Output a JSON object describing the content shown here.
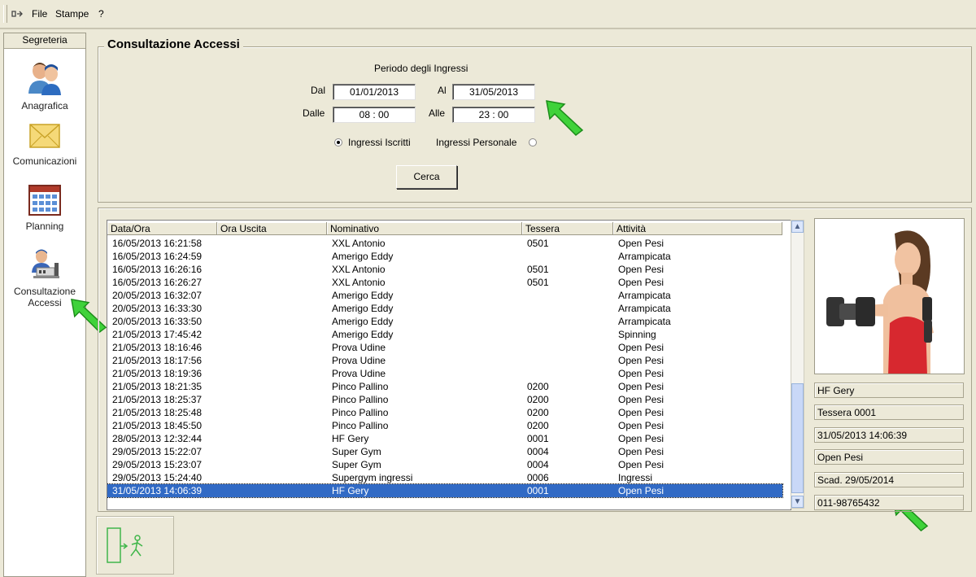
{
  "menu": {
    "items": [
      "File",
      "Stampe",
      "?"
    ]
  },
  "sidebar": {
    "title": "Segreteria",
    "items": [
      {
        "label": "Anagrafica",
        "icon": "people-icon"
      },
      {
        "label": "Comunicazioni",
        "icon": "envelope-icon"
      },
      {
        "label": "Planning",
        "icon": "calendar-grid-icon"
      },
      {
        "label1": "Consultazione",
        "label2": "Accessi",
        "icon": "access-control-icon"
      }
    ]
  },
  "filter": {
    "title": "Consultazione Accessi",
    "period_label": "Periodo degli Ingressi",
    "dal_label": "Dal",
    "dal_value": "01/01/2013",
    "al_label": "Al",
    "al_value": "31/05/2013",
    "dalle_label": "Dalle",
    "dalle_value": "08 : 00",
    "alle_label": "Alle",
    "alle_value": "23 : 00",
    "radio_iscritti": "Ingressi Iscritti",
    "radio_personale": "Ingressi Personale",
    "selected_radio": "Ingressi Iscritti",
    "search_label": "Cerca"
  },
  "table": {
    "columns": [
      "Data/Ora",
      "Ora Uscita",
      "Nominativo",
      "Tessera",
      "Attività"
    ],
    "rows": [
      [
        "16/05/2013 16:21:58",
        "",
        "XXL Antonio",
        "0501",
        "Open Pesi"
      ],
      [
        "16/05/2013 16:24:59",
        "",
        "Amerigo Eddy",
        "",
        "Arrampicata"
      ],
      [
        "16/05/2013 16:26:16",
        "",
        "XXL Antonio",
        "0501",
        "Open Pesi"
      ],
      [
        "16/05/2013 16:26:27",
        "",
        "XXL Antonio",
        "0501",
        "Open Pesi"
      ],
      [
        "20/05/2013 16:32:07",
        "",
        "Amerigo Eddy",
        "",
        "Arrampicata"
      ],
      [
        "20/05/2013 16:33:30",
        "",
        "Amerigo Eddy",
        "",
        "Arrampicata"
      ],
      [
        "20/05/2013 16:33:50",
        "",
        "Amerigo Eddy",
        "",
        "Arrampicata"
      ],
      [
        "21/05/2013 17:45:42",
        "",
        "Amerigo Eddy",
        "",
        "Spinning"
      ],
      [
        "21/05/2013 18:16:46",
        "",
        "Prova Udine",
        "",
        "Open Pesi"
      ],
      [
        "21/05/2013 18:17:56",
        "",
        "Prova Udine",
        "",
        "Open Pesi"
      ],
      [
        "21/05/2013 18:19:36",
        "",
        "Prova Udine",
        "",
        "Open Pesi"
      ],
      [
        "21/05/2013 18:21:35",
        "",
        "Pinco Pallino",
        "0200",
        "Open Pesi"
      ],
      [
        "21/05/2013 18:25:37",
        "",
        "Pinco Pallino",
        "0200",
        "Open Pesi"
      ],
      [
        "21/05/2013 18:25:48",
        "",
        "Pinco Pallino",
        "0200",
        "Open Pesi"
      ],
      [
        "21/05/2013 18:45:50",
        "",
        "Pinco Pallino",
        "0200",
        "Open Pesi"
      ],
      [
        "28/05/2013 12:32:44",
        "",
        "HF Gery",
        "0001",
        "Open Pesi"
      ],
      [
        "29/05/2013 15:22:07",
        "",
        "Super Gym",
        "0004",
        "Open Pesi"
      ],
      [
        "29/05/2013 15:23:07",
        "",
        "Super Gym",
        "0004",
        "Open Pesi"
      ],
      [
        "29/05/2013 15:24:40",
        "",
        "Supergym ingressi",
        "0006",
        "Ingressi"
      ],
      [
        "31/05/2013 14:06:39",
        "",
        "HF Gery",
        "0001",
        "Open Pesi"
      ]
    ],
    "selected_row": 19
  },
  "details": {
    "name": "HF Gery",
    "card": "Tessera 0001",
    "datetime": "31/05/2013 14:06:39",
    "activity": "Open Pesi",
    "expiry": "Scad. 29/05/2014",
    "phone": "011-98765432"
  },
  "colors": {
    "selection": "#316ac5",
    "highlight_arrow": "#33cc33"
  }
}
